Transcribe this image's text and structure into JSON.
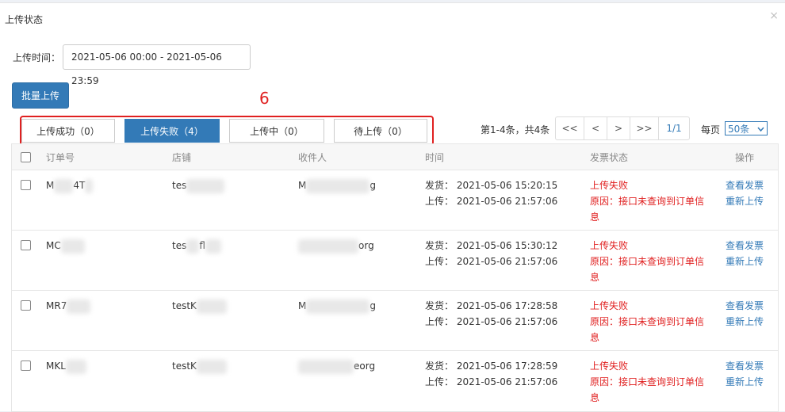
{
  "dialog": {
    "title": "上传状态",
    "close": "×"
  },
  "filter": {
    "time_label": "上传时间：",
    "time_value": "2021-05-06 00:00 - 2021-05-06 23:59"
  },
  "batch_upload": "批量上传",
  "annotation": "6",
  "tabs": [
    {
      "label": "上传成功（0）",
      "active": false
    },
    {
      "label": "上传失败（4）",
      "active": true
    },
    {
      "label": "上传中（0）",
      "active": false
    },
    {
      "label": "待上传（0）",
      "active": false
    }
  ],
  "pager": {
    "info": "第1-4条，共4条",
    "first": "<<",
    "prev": "<",
    "next": ">",
    "last": ">>",
    "page": "1/1",
    "per_label": "每页",
    "per_value": "50条"
  },
  "columns": {
    "order": "订单号",
    "shop": "店铺",
    "receiver": "收件人",
    "time": "时间",
    "status": "发票状态",
    "action": "操作"
  },
  "rows": [
    {
      "order_pre": "M",
      "order_post": "4T",
      "shop_pre": "tes",
      "shop_post": "",
      "recv_pre": "M",
      "recv_post": "g",
      "ship": "发货：  2021-05-06 15:20:15",
      "upload": "上传：  2021-05-06 21:57:06",
      "status": "上传失败",
      "reason1": "原因：接口未查询到订单信",
      "reason2": "息",
      "view": "查看发票",
      "reupload": "重新上传"
    },
    {
      "order_pre": "MC",
      "order_post": "",
      "shop_pre": "tes",
      "shop_post": "fl",
      "recv_pre": "",
      "recv_post": "org",
      "ship": "发货：  2021-05-06 15:30:12",
      "upload": "上传：  2021-05-06 21:57:06",
      "status": "上传失败",
      "reason1": "原因：接口未查询到订单信",
      "reason2": "息",
      "view": "查看发票",
      "reupload": "重新上传"
    },
    {
      "order_pre": "MR7",
      "order_post": "",
      "shop_pre": "testK",
      "shop_post": "",
      "recv_pre": "M",
      "recv_post": "g",
      "ship": "发货：  2021-05-06 17:28:58",
      "upload": "上传：  2021-05-06 21:57:06",
      "status": "上传失败",
      "reason1": "原因：接口未查询到订单信",
      "reason2": "息",
      "view": "查看发票",
      "reupload": "重新上传"
    },
    {
      "order_pre": "MKL",
      "order_post": "",
      "shop_pre": "testK",
      "shop_post": "",
      "recv_pre": "",
      "recv_post": "eorg",
      "ship": "发货：  2021-05-06 17:28:59",
      "upload": "上传：  2021-05-06 21:57:06",
      "status": "上传失败",
      "reason1": "原因：接口未查询到订单信",
      "reason2": "息",
      "view": "查看发票",
      "reupload": "重新上传"
    }
  ],
  "colors": {
    "primary": "#337ab7",
    "danger": "#e02020"
  }
}
